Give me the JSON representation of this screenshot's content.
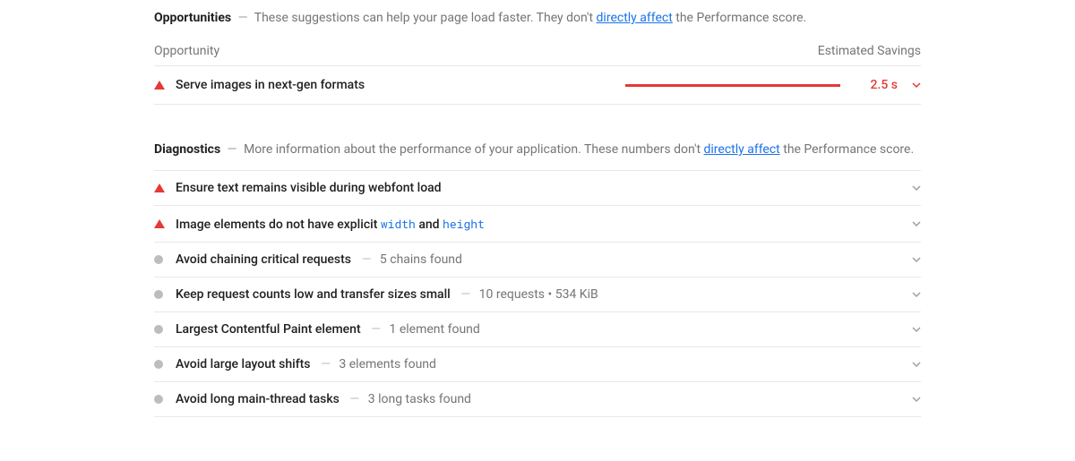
{
  "opportunities": {
    "title": "Opportunities",
    "desc_pre": "These suggestions can help your page load faster. They don't ",
    "link": "directly affect",
    "desc_post": " the Performance score.",
    "col_opportunity": "Opportunity",
    "col_savings": "Estimated Savings",
    "items": [
      {
        "title": "Serve images in next-gen formats",
        "savings": "2.5 s"
      }
    ]
  },
  "diagnostics": {
    "title": "Diagnostics",
    "desc_pre": "More information about the performance of your application. These numbers don't ",
    "link": "directly affect",
    "desc_post": " the Performance score.",
    "items": [
      {
        "severity": "high",
        "title": "Ensure text remains visible during webfont load",
        "detail": ""
      },
      {
        "severity": "high",
        "title_pre": "Image elements do not have explicit ",
        "code1": "width",
        "mid": " and ",
        "code2": "height",
        "detail": ""
      },
      {
        "severity": "info",
        "title": "Avoid chaining critical requests",
        "detail": "5 chains found"
      },
      {
        "severity": "info",
        "title": "Keep request counts low and transfer sizes small",
        "detail": "10 requests • 534 KiB"
      },
      {
        "severity": "info",
        "title": "Largest Contentful Paint element",
        "detail": "1 element found"
      },
      {
        "severity": "info",
        "title": "Avoid large layout shifts",
        "detail": "3 elements found"
      },
      {
        "severity": "info",
        "title": "Avoid long main-thread tasks",
        "detail": "3 long tasks found"
      }
    ]
  }
}
